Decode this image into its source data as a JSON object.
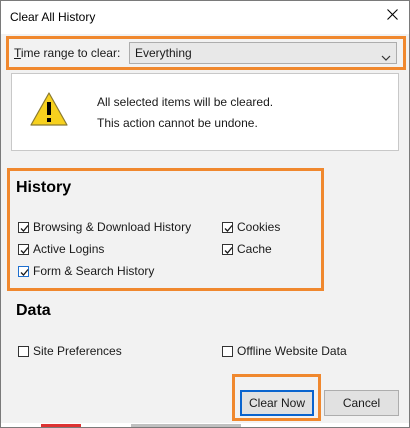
{
  "window": {
    "title": "Clear All History",
    "close_icon": "close-icon"
  },
  "time_range": {
    "label_underlined": "T",
    "label_rest": "ime range to clear:",
    "selected": "Everything",
    "icon": "chevron-down-icon"
  },
  "warning": {
    "icon": "warning-triangle-icon",
    "line1": "All selected items will be cleared.",
    "line2": "This action cannot be undone."
  },
  "history": {
    "title": "History",
    "items": [
      {
        "label": "Browsing & Download History",
        "checked": true
      },
      {
        "label": "Cookies",
        "checked": true
      },
      {
        "label": "Active Logins",
        "checked": true
      },
      {
        "label": "Cache",
        "checked": true
      },
      {
        "label": "Form & Search History",
        "checked": true
      }
    ]
  },
  "data": {
    "title": "Data",
    "items": [
      {
        "label": "Site Preferences",
        "checked": false
      },
      {
        "label": "Offline Website Data",
        "checked": false
      }
    ]
  },
  "buttons": {
    "clear_now": "Clear Now",
    "cancel": "Cancel"
  },
  "colors": {
    "highlight": "#f0882e",
    "primary_border": "#0a64ce",
    "checkmark": "#1a1a1a"
  }
}
